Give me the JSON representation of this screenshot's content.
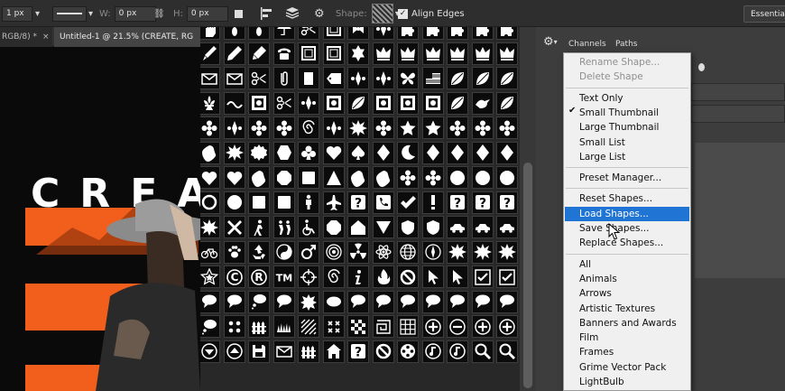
{
  "options_bar": {
    "stroke_width": "1 px",
    "w_label": "W:",
    "w_value": "0 px",
    "h_label": "H:",
    "h_value": "0 px",
    "shape_label": "Shape:",
    "align_edges_label": "Align Edges",
    "align_edges_checked": true,
    "workspace": "Essentials"
  },
  "doc_tabs": [
    {
      "label": "RGB/8) *",
      "close": "×"
    },
    {
      "label": "Untitled-1 @ 21.5% (CREATE, RG"
    }
  ],
  "canvas": {
    "headline_letters": [
      "C",
      "R",
      "E",
      "A"
    ],
    "accent": "#f25e1b"
  },
  "panels": {
    "tabs": [
      "Channels",
      "Paths"
    ]
  },
  "menu": {
    "items": [
      {
        "label": "Rename Shape...",
        "disabled": true
      },
      {
        "label": "Delete Shape",
        "disabled": true
      },
      {
        "sep": true
      },
      {
        "label": "Text Only"
      },
      {
        "label": "Small Thumbnail",
        "checked": true
      },
      {
        "label": "Large Thumbnail"
      },
      {
        "label": "Small List"
      },
      {
        "label": "Large List"
      },
      {
        "sep": true
      },
      {
        "label": "Preset Manager..."
      },
      {
        "sep": true
      },
      {
        "label": "Reset Shapes..."
      },
      {
        "label": "Load Shapes...",
        "highlighted": true
      },
      {
        "label": "Save Shapes..."
      },
      {
        "label": "Replace Shapes..."
      },
      {
        "sep": true
      },
      {
        "label": "All"
      },
      {
        "label": "Animals"
      },
      {
        "label": "Arrows"
      },
      {
        "label": "Artistic Textures"
      },
      {
        "label": "Banners and Awards"
      },
      {
        "label": "Film"
      },
      {
        "label": "Frames"
      },
      {
        "label": "Grime Vector Pack"
      },
      {
        "label": "LightBulb"
      }
    ],
    "check_glyph": "✔",
    "highlight_color": "#1f74d4"
  },
  "shape_grid": {
    "rows": [
      [
        "hand",
        "footprint",
        "footprint",
        "umbrella",
        "scissors",
        "frame",
        "ribbon",
        "ornament",
        "puzzle",
        "puzzle",
        "puzzle",
        "puzzle",
        "puzzle",
        "puzzle",
        "puzzle"
      ],
      [
        "brush",
        "pencil",
        "marker",
        "telephone",
        "frame",
        "frame",
        "star6",
        "crown",
        "crown",
        "crown",
        "crown",
        "crown",
        "crown",
        "crown",
        "crown"
      ],
      [
        "envelope",
        "envelope",
        "scissors",
        "paperclip",
        "rectangle",
        "tag",
        "ornament",
        "ornament",
        "butterfly",
        "flag",
        "leaf",
        "leaf",
        "leaf",
        "leaf",
        "leaf"
      ],
      [
        "fleur",
        "scroll",
        "tile",
        "scissors",
        "ornament",
        "tile",
        "leaf",
        "tile",
        "tile",
        "tile",
        "leaf",
        "bird",
        "leaf",
        "leaf",
        "leaf"
      ],
      [
        "flower",
        "ornament",
        "flower",
        "flower",
        "spiral",
        "ornament",
        "starburst",
        "flower",
        "star",
        "star",
        "flower",
        "flower",
        "flower",
        "flower",
        "flower"
      ],
      [
        "blob",
        "starburst",
        "seal",
        "hexagon",
        "club",
        "heart",
        "spade",
        "diamond",
        "moon",
        "diamond",
        "diamond",
        "diamond",
        "diamond",
        "diamond",
        "diamond"
      ],
      [
        "heart",
        "heart",
        "blob",
        "octagon",
        "square",
        "triangle",
        "blob",
        "blob",
        "flower",
        "flower",
        "circle",
        "circle",
        "circle",
        "circle",
        "circle"
      ],
      [
        "ring",
        "circle",
        "square",
        "square",
        "person",
        "plane",
        "question",
        "phone",
        "check",
        "exclaim",
        "question",
        "question",
        "question",
        "question",
        "question"
      ],
      [
        "starburst",
        "cross",
        "walker",
        "pedestrians",
        "wheelchair",
        "octagon",
        "house",
        "triangleDown",
        "shield",
        "shield",
        "car",
        "car",
        "car",
        "car",
        "car"
      ],
      [
        "bicycle",
        "paw",
        "recycle",
        "yinyang",
        "male",
        "target",
        "radiation",
        "atom",
        "globe",
        "compass",
        "starburst",
        "starburst",
        "starburst",
        "starburst",
        "starburst"
      ],
      [
        "starframe",
        "copyright",
        "registered",
        "tm",
        "crosshair",
        "spiral",
        "info",
        "fire",
        "noSign",
        "cursor",
        "cursor",
        "checkbox",
        "checkbox",
        "checkbox",
        "checkbox"
      ],
      [
        "speech",
        "speech",
        "thought",
        "speech",
        "burst",
        "oval",
        "speech",
        "speech",
        "speech",
        "speech",
        "speech",
        "speech",
        "speech",
        "speech",
        "speech"
      ],
      [
        "thought",
        "flowers",
        "fence",
        "grass",
        "diagonal",
        "crosses",
        "checker",
        "maze",
        "grid",
        "plus",
        "minus",
        "plus",
        "plus",
        "plus",
        "plus"
      ],
      [
        "downArrow",
        "upArrow",
        "save",
        "envelope",
        "fence",
        "home",
        "question",
        "noSign",
        "film",
        "note",
        "note",
        "magnifier",
        "magnifier",
        "magnifier",
        "magnifier"
      ]
    ]
  },
  "colors": {
    "cell_bg": "#0b0b0b",
    "cell_border": "#3d3d3d",
    "glyph": "#ffffff"
  }
}
